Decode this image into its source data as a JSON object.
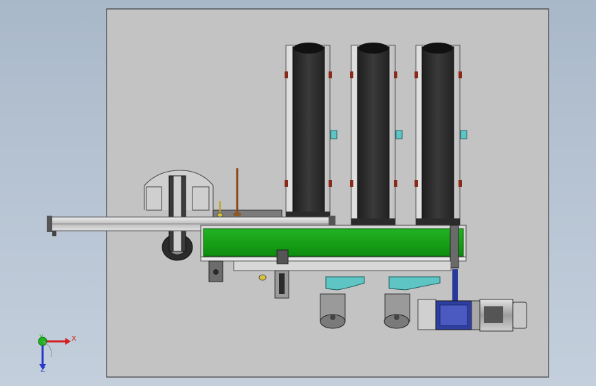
{
  "triad": {
    "x_label": "X",
    "y_label": "Y",
    "z_label": "Z",
    "x_color": "#d21f1f",
    "y_color": "#1fb41f",
    "z_color": "#2737c9"
  },
  "colors": {
    "background_top": "#a9b8c9",
    "sheet": "#c3c3c3",
    "conveyor_belt": "#15a315",
    "roller_dark": "#2f2f2f",
    "bracket_teal": "#5fc4c4",
    "motor_blue": "#2f3f9f",
    "motor_grey": "#b8b8b8"
  },
  "icons": [
    "axis-triad-icon"
  ]
}
